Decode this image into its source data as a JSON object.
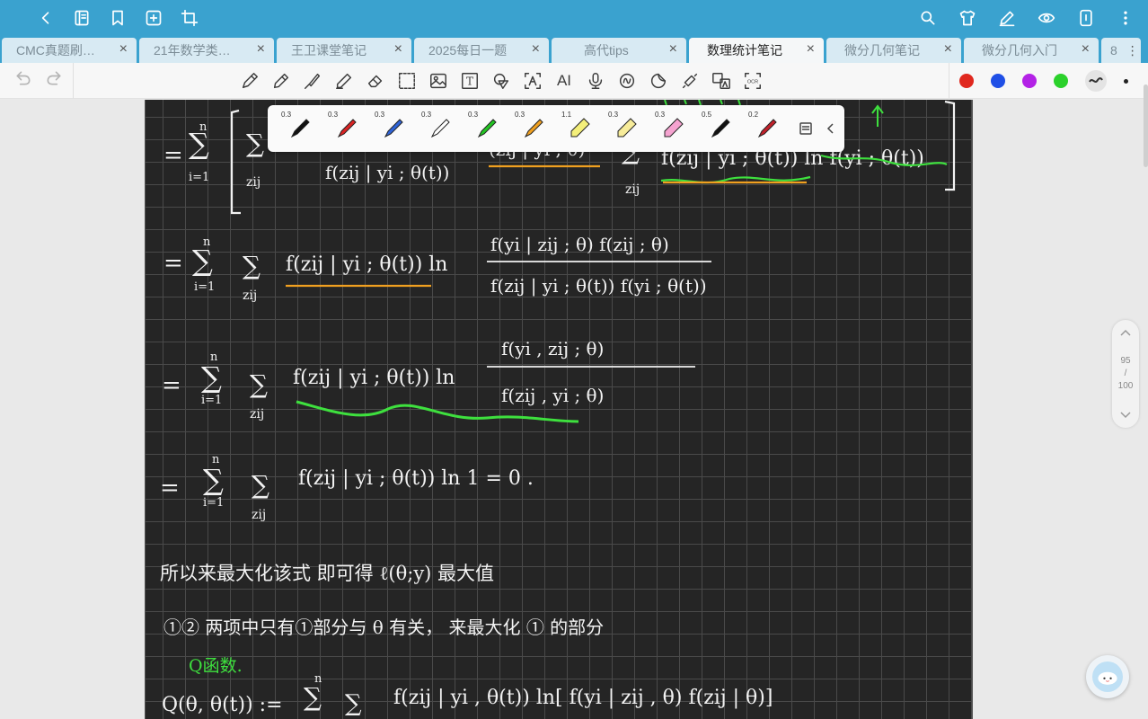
{
  "tabs": [
    {
      "label": "CMC真题刷…",
      "active": false
    },
    {
      "label": "21年数学类…",
      "active": false
    },
    {
      "label": "王卫课堂笔记",
      "active": false
    },
    {
      "label": "2025每日一题",
      "active": false
    },
    {
      "label": "高代tips",
      "active": false
    },
    {
      "label": "数理统计笔记",
      "active": true
    },
    {
      "label": "微分几何笔记",
      "active": false
    },
    {
      "label": "微分几何入门",
      "active": false
    }
  ],
  "tab_overflow_count": "8",
  "tab_close_glyph": "×",
  "toolbar": {
    "text_tool": "T",
    "ai_tool": "AI",
    "ocr_tool": "OCR"
  },
  "colors": [
    "#e0281e",
    "#1f4fe6",
    "#b322e6",
    "#2bd12b"
  ],
  "pens": [
    {
      "size": "0.3",
      "color": "#111111",
      "icon": "pen-black-icon"
    },
    {
      "size": "0.3",
      "color": "#d92424",
      "icon": "pen-red-icon"
    },
    {
      "size": "0.3",
      "color": "#2f63d6",
      "icon": "pen-blue-icon"
    },
    {
      "size": "0.3",
      "color": "#ffffff",
      "icon": "pen-white-icon"
    },
    {
      "size": "0.3",
      "color": "#22c422",
      "icon": "pen-green-icon"
    },
    {
      "size": "0.3",
      "color": "#f0a020",
      "icon": "pen-orange-icon"
    },
    {
      "size": "1.1",
      "color": "#f4ef7a",
      "icon": "highlighter-yellow-icon"
    },
    {
      "size": "0.3",
      "color": "#f7ec9a",
      "icon": "pen-lightyellow-icon"
    },
    {
      "size": "0.3",
      "color": "#f5a3d0",
      "icon": "highlighter-pink-icon"
    },
    {
      "size": "0.5",
      "color": "#111111",
      "icon": "pen-black-icon"
    },
    {
      "size": "0.2",
      "color": "#c0202a",
      "icon": "pen-darkred-icon"
    }
  ],
  "page_indicator": {
    "current": "95",
    "sep": "/",
    "total": "100"
  },
  "notes": {
    "line1_prefix": "= Σ",
    "line2": "f(zij | yi ; θ(t)) ln",
    "line2_num": "f(yi | zij ; θ) f(zij ; θ)",
    "line2_den": "f(zij | yi ; θ(t)) f(yi ; θ(t))",
    "line1_den": "f(zij | yi ; θ(t))",
    "line1_tail": "f(zij | yi ; θ(t)) ln f(yi ; θ(t))",
    "line3": "f(zij | yi ; θ(t)) ln",
    "line3_num": "f(yi , zij ; θ)",
    "line3_den": "f(zij , yi ; θ)",
    "line4": "f(zij | yi ; θ(t)) ln 1 = 0 .",
    "sum_top": "n",
    "sum_bottom": "i=1",
    "sum_inner": "zij",
    "text1": "所以来最大化该式 即可得 ℓ(θ;y) 最大值",
    "text2": "①② 两项中只有①部分与 θ 有关， 来最大化 ① 的部分",
    "q_label": "Q函数.",
    "q_def": "Q(θ, θ(t)) :=",
    "q_def_tail": "f(zij | yi , θ(t)) ln[ f(yi | zij , θ) f(zij | θ)]"
  }
}
